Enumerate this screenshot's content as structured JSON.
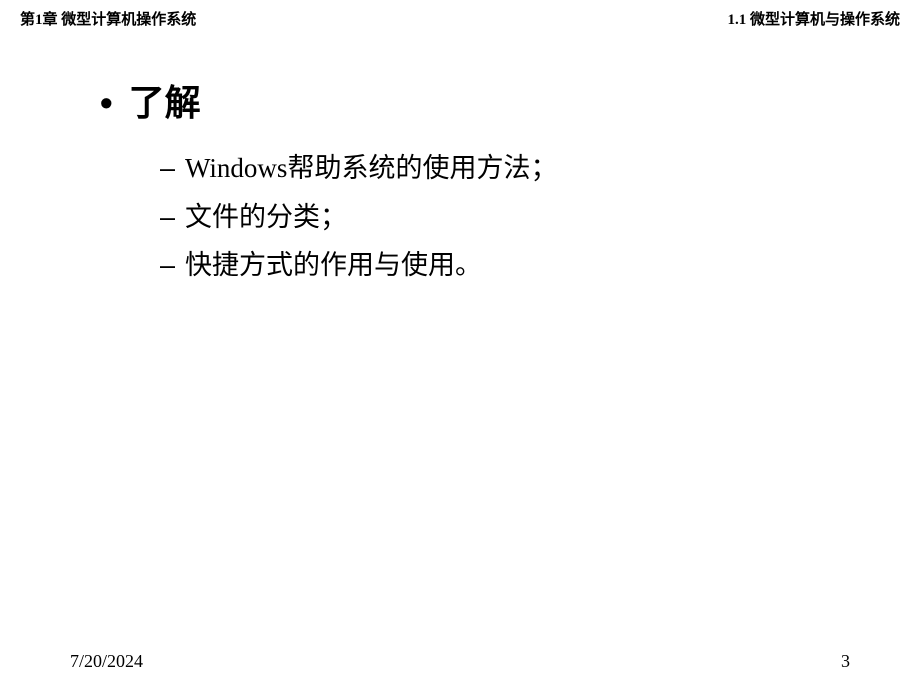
{
  "header": {
    "left": "第1章  微型计算机操作系统",
    "right": "1.1  微型计算机与操作系统"
  },
  "content": {
    "bullet_title": "了解",
    "sub_items": [
      "Windows帮助系统的使用方法；",
      "文件的分类；",
      "快捷方式的作用与使用。"
    ]
  },
  "footer": {
    "date": "7/20/2024",
    "page": "3"
  }
}
